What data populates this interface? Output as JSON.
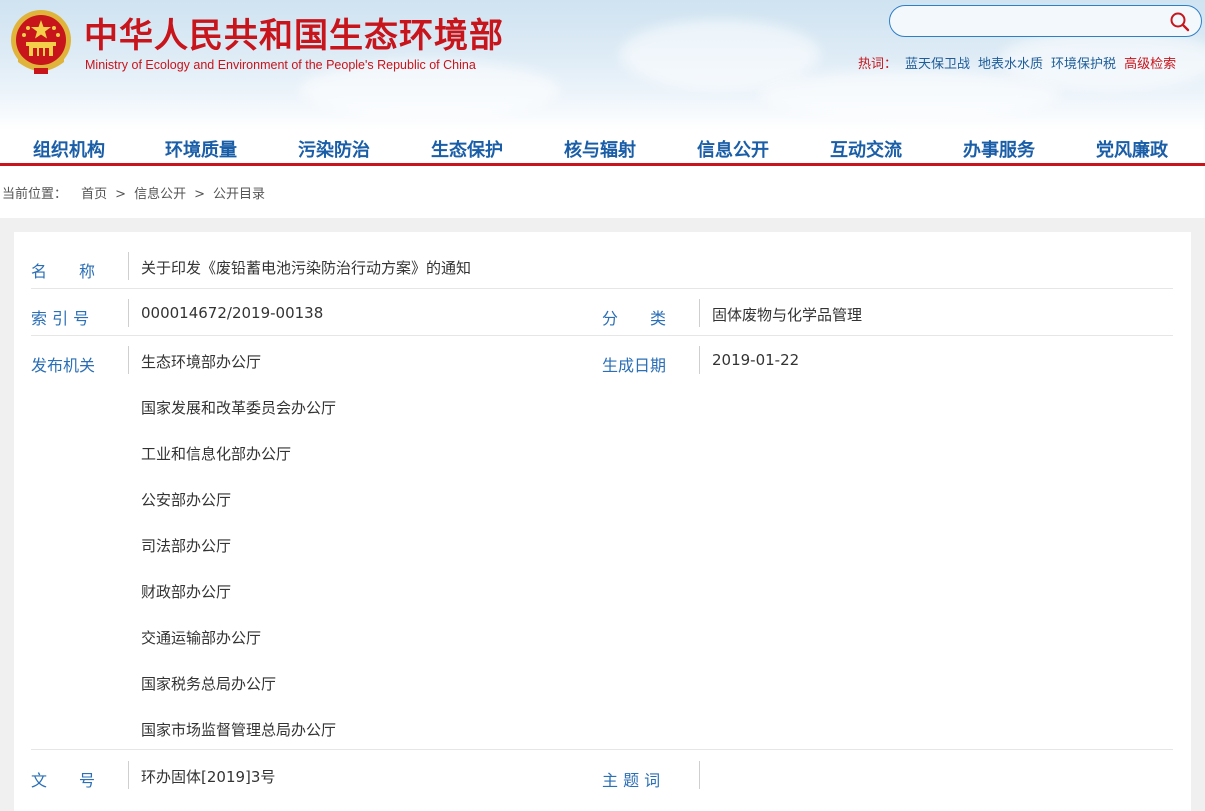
{
  "site": {
    "name_cn": "中华人民共和国生态环境部",
    "name_en": "Ministry of Ecology and Environment of the People's Republic of China"
  },
  "search": {
    "placeholder": "",
    "icon": "search-icon"
  },
  "hotwords": {
    "label": "热词：",
    "items": [
      "蓝天保卫战",
      "地表水水质",
      "环境保护税"
    ],
    "advanced": "高级检索"
  },
  "nav": {
    "items": [
      "组织机构",
      "环境质量",
      "污染防治",
      "生态保护",
      "核与辐射",
      "信息公开",
      "互动交流",
      "办事服务",
      "党风廉政"
    ]
  },
  "breadcrumb": {
    "label": "当前位置：",
    "items": [
      "首页",
      "信息公开",
      "公开目录"
    ],
    "separator": ">"
  },
  "doc": {
    "name_label": "名　　称",
    "name_value": "关于印发《废铅蓄电池污染防治行动方案》的通知",
    "index_label": "索 引 号",
    "index_value": "000014672/2019-00138",
    "category_label": "分　　类",
    "category_value": "固体废物与化学品管理",
    "issuer_label": "发布机关",
    "issuers": [
      "生态环境部办公厅",
      "国家发展和改革委员会办公厅",
      "工业和信息化部办公厅",
      "公安部办公厅",
      "司法部办公厅",
      "财政部办公厅",
      "交通运输部办公厅",
      "国家税务总局办公厅",
      "国家市场监督管理总局办公厅"
    ],
    "date_label": "生成日期",
    "date_value": "2019-01-22",
    "docno_label": "文　　号",
    "docno_value": "环办固体[2019]3号",
    "keywords_label": "主 题 词",
    "keywords_value": ""
  },
  "colors": {
    "brand_red": "#c8141b",
    "nav_blue": "#1a5ea8",
    "label_blue": "#2b6fb6"
  }
}
